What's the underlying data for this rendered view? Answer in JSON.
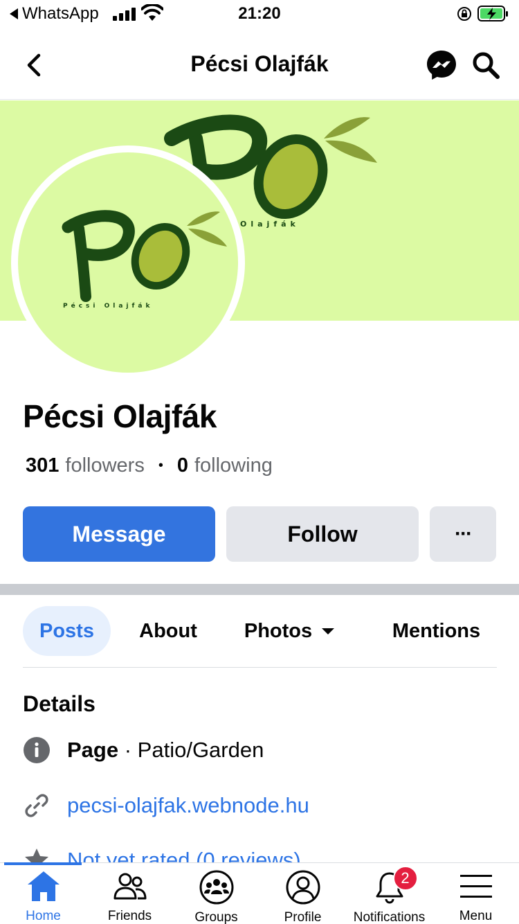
{
  "status_bar": {
    "back_app": "WhatsApp",
    "time": "21:20"
  },
  "header": {
    "title": "Pécsi Olajfák",
    "back_icon": "chevron-left-icon",
    "messenger_icon": "messenger-icon",
    "search_icon": "search-icon"
  },
  "logo": {
    "letters": "PO",
    "tagline_cover": "Olajfák",
    "tagline_avatar": "Pécsi Olajfák"
  },
  "profile": {
    "name": "Pécsi Olajfák",
    "followers_count": "301",
    "followers_label": "followers",
    "separator": "•",
    "following_count": "0",
    "following_label": "following"
  },
  "actions": {
    "message": "Message",
    "follow": "Follow",
    "more": "···"
  },
  "tabs": [
    {
      "label": "Posts",
      "active": true
    },
    {
      "label": "About"
    },
    {
      "label": "Photos"
    },
    {
      "label": "Mentions"
    }
  ],
  "details": {
    "title": "Details",
    "page_type_label": "Page",
    "page_type_separator": " · ",
    "page_category": "Patio/Garden",
    "website": "pecsi-olajfak.webnode.hu",
    "rating": "Not yet rated (0 reviews)"
  },
  "bottom_nav": [
    {
      "label": "Home",
      "icon": "home-icon",
      "active": true
    },
    {
      "label": "Friends",
      "icon": "friends-icon"
    },
    {
      "label": "Groups",
      "icon": "groups-icon"
    },
    {
      "label": "Profile",
      "icon": "profile-icon"
    },
    {
      "label": "Notifications",
      "icon": "bell-icon",
      "badge": "2"
    },
    {
      "label": "Menu",
      "icon": "menu-icon"
    }
  ],
  "colors": {
    "accent": "#2d74e5",
    "cover_background": "#dcfaa3",
    "logo_dark_green": "#1b4a14",
    "olive": "#a9bd3a",
    "badge": "#e41e3f"
  }
}
